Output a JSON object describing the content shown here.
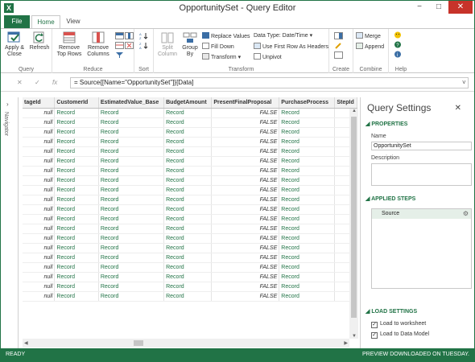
{
  "window": {
    "title": "OpportunitySet - Query Editor",
    "app_icon": "X",
    "minimize": "−",
    "maximize": "□",
    "close": "✕"
  },
  "tabs": {
    "file": "File",
    "home": "Home",
    "view": "View"
  },
  "ribbon": {
    "query": {
      "label": "Query",
      "apply_close": "Apply & Close",
      "refresh": "Refresh"
    },
    "reduce": {
      "label": "Reduce",
      "remove_top_rows": "Remove Top Rows",
      "remove_columns": "Remove Columns"
    },
    "sort": {
      "label": "Sort"
    },
    "transform": {
      "label": "Transform",
      "split_column": "Split Column",
      "group_by": "Group By",
      "replace_values": "Replace Values",
      "fill_down": "Fill Down",
      "transform_menu": "Transform",
      "data_type": "Data Type: Date/Time",
      "first_row_headers": "Use First Row As Headers",
      "unpivot": "Unpivot"
    },
    "create": {
      "label": "Create"
    },
    "combine": {
      "label": "Combine",
      "merge": "Merge",
      "append": "Append"
    },
    "help": {
      "label": "Help"
    }
  },
  "formula": {
    "cancel": "✕",
    "commit": "✓",
    "fx": "fx",
    "text": "= Source{[Name=\"OpportunitySet\"]}[Data]",
    "expand": "˅"
  },
  "navigator": {
    "label": "Navigator",
    "chevron": "›"
  },
  "grid": {
    "columns": [
      "tageId",
      "CustomerId",
      "EstimatedValue_Base",
      "BudgetAmount",
      "PresentFinalProposal",
      "PurchaseProcess",
      "StepId"
    ],
    "row_template": [
      "null",
      "Record",
      "Record",
      "Record",
      "FALSE",
      "Record",
      ""
    ],
    "row_count": 20
  },
  "query_settings": {
    "title": "Query Settings",
    "close": "✕",
    "properties_header": "PROPERTIES",
    "name_label": "Name",
    "name_value": "OpportunitySet",
    "description_label": "Description",
    "description_value": "",
    "applied_steps_header": "APPLIED STEPS",
    "steps": [
      "Source"
    ],
    "load_settings_header": "LOAD SETTINGS",
    "load_to_worksheet": "Load to worksheet",
    "load_to_data_model": "Load to Data Model"
  },
  "status": {
    "left": "READY",
    "right": "PREVIEW DOWNLOADED ON TUESDAY."
  },
  "colors": {
    "accent": "#217346",
    "step_highlight": "#e5efe8"
  }
}
